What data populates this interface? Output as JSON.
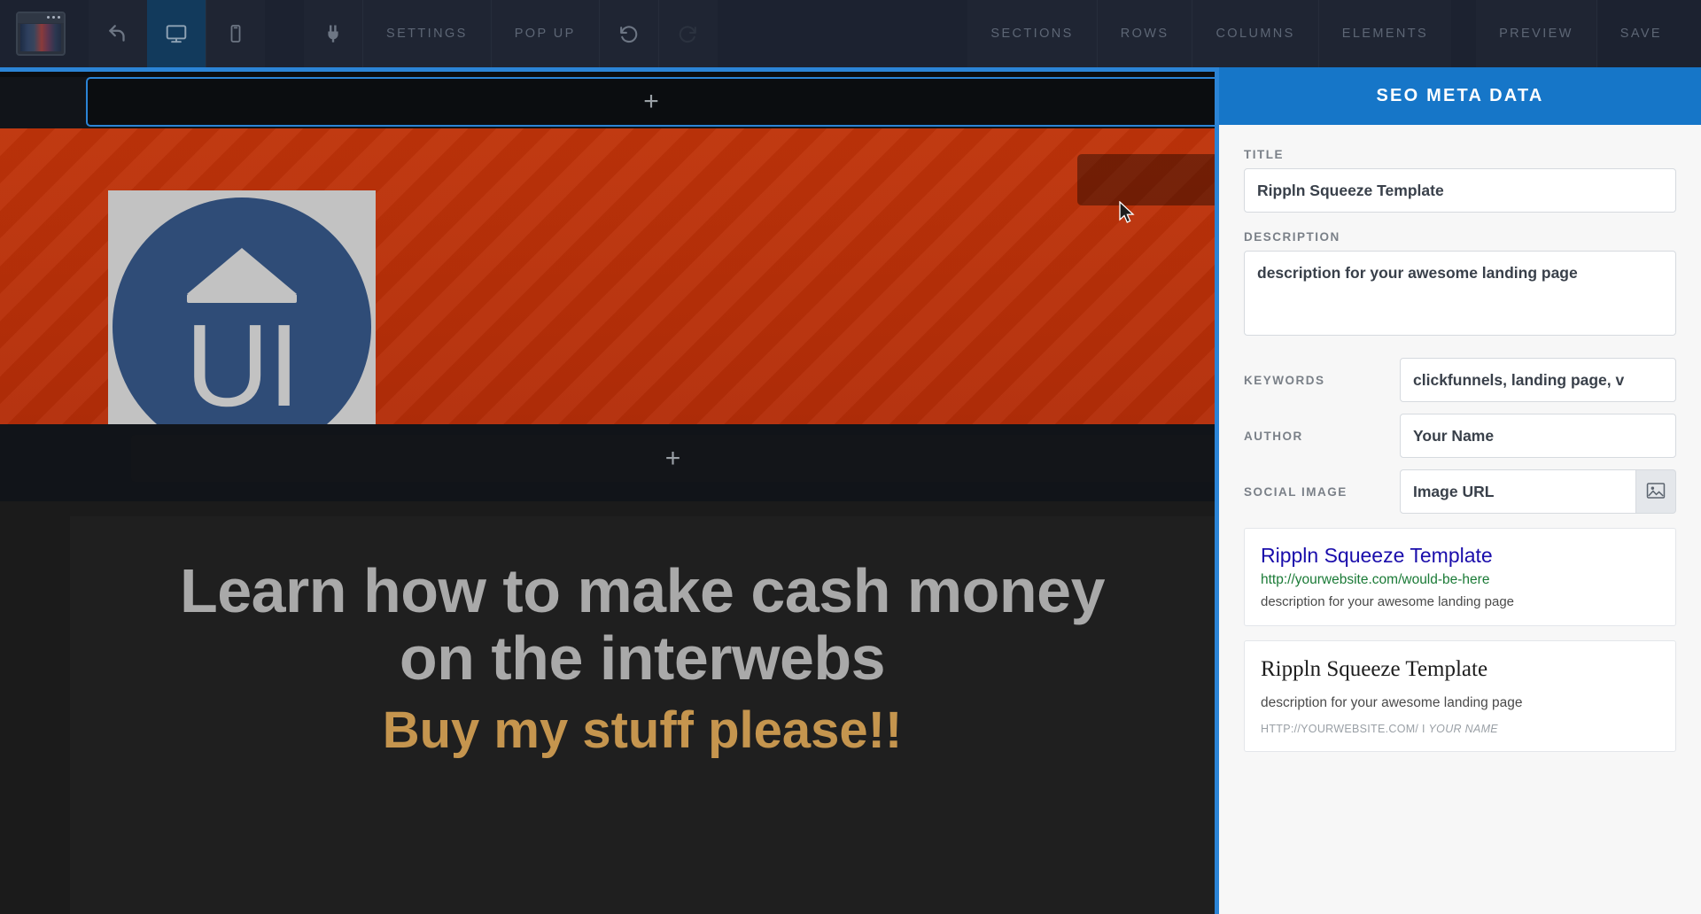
{
  "toolbar": {
    "logo_icon": "browser-window-icon",
    "undo_icon": "undo-arrow-icon",
    "desktop_icon": "desktop-monitor-icon",
    "mobile_icon": "mobile-phone-icon",
    "plug_icon": "plug-integration-icon",
    "settings_label": "SETTINGS",
    "popup_label": "POP UP",
    "history_icon": "history-revert-icon",
    "redo_icon": "redo-icon",
    "sections_label": "SECTIONS",
    "rows_label": "ROWS",
    "columns_label": "COLUMNS",
    "elements_label": "ELEMENTS",
    "preview_label": "PREVIEW",
    "save_label": "SAVE"
  },
  "canvas": {
    "add_section_glyph": "+",
    "hero": {
      "logo_icon": "ui-circle-logo",
      "logo_text": "UI"
    },
    "content": {
      "headline_line1": "Learn how to make cash money",
      "headline_line2": "on the interwebs",
      "subheadline": "Buy my stuff please!!"
    }
  },
  "panel": {
    "header_title": "SEO META DATA",
    "title": {
      "label": "TITLE",
      "value": "Rippln Squeeze Template"
    },
    "description": {
      "label": "DESCRIPTION",
      "value": "description for your awesome landing page"
    },
    "keywords": {
      "label": "KEYWORDS",
      "value": "clickfunnels, landing page, v"
    },
    "author": {
      "label": "AUTHOR",
      "value": "Your Name"
    },
    "social_image": {
      "label": "SOCIAL IMAGE",
      "value": "Image URL",
      "browse_icon": "image-picker-icon"
    },
    "google_preview": {
      "title": "Rippln Squeeze Template",
      "url": "http://yourwebsite.com/would-be-here",
      "description": "description for your awesome landing page"
    },
    "social_preview": {
      "title": "Rippln Squeeze Template",
      "description": "description for your awesome landing page",
      "meta_url": "HTTP://YOURWEBSITE.COM/ I ",
      "meta_author": "YOUR NAME"
    }
  },
  "colors": {
    "accent_blue": "#1676c8",
    "panel_border": "#2b84d6",
    "toolbar_bg": "#1c2230",
    "hero_red": "#bf3309",
    "subheadline_gold": "#c5954e",
    "google_title": "#1a0dab",
    "google_url": "#1a7a36"
  }
}
